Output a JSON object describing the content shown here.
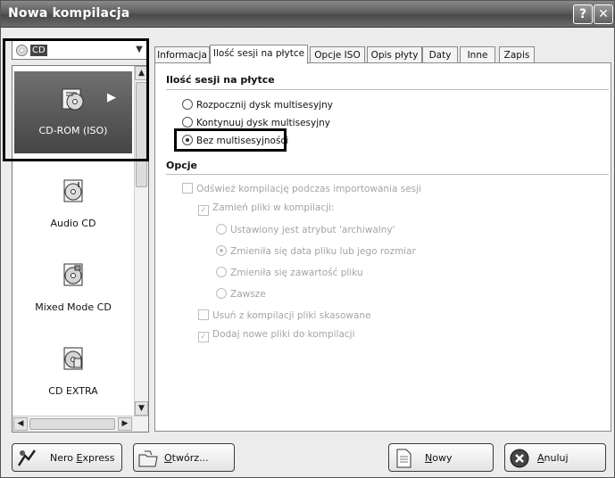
{
  "window": {
    "title": "Nowa kompilacja",
    "help_glyph": "?",
    "close_glyph": "✕"
  },
  "left": {
    "combo_value": "CD",
    "items": [
      {
        "label": "CD-ROM (ISO)",
        "icon": "cd-rom-iso-icon",
        "selected": true
      },
      {
        "label": "Audio CD",
        "icon": "audio-cd-icon"
      },
      {
        "label": "Mixed Mode CD",
        "icon": "mixed-mode-cd-icon"
      },
      {
        "label": "CD EXTRA",
        "icon": "cd-extra-icon"
      }
    ]
  },
  "tabs": [
    "Informacja",
    "Ilość sesji na płytce",
    "Opcje ISO",
    "Opis płyty",
    "Daty",
    "Inne",
    "Zapis"
  ],
  "active_tab": 1,
  "session": {
    "title": "Ilość sesji na płytce",
    "opt_start": "Rozpocznij dysk multisesyjny",
    "opt_continue": "Kontynuuj dysk multisesyjny",
    "opt_none": "Bez multisesyjności"
  },
  "options": {
    "title": "Opcje",
    "refresh": "Odśwież kompilację podczas importowania sesji",
    "replace": "Zamień pliki w kompilacji:",
    "archive": "Ustawiony jest atrybut 'archiwalny'",
    "date_size": "Zmieniła się data pliku lub jego rozmiar",
    "content": "Zmieniła się zawartość pliku",
    "always": "Zawsze",
    "remove_deleted": "Usuń z kompilacji pliki skasowane",
    "add_new": "Dodaj nowe pliki do kompilacji"
  },
  "buttons": {
    "nero_express_pre": "Nero ",
    "nero_express_key": "E",
    "nero_express_post": "xpress",
    "open_key": "O",
    "open_post": "twórz...",
    "new_key": "N",
    "new_post": "owy",
    "cancel_key": "A",
    "cancel_post": "nuluj"
  },
  "colors": {
    "title_bar": "#5c5c5c",
    "selected_item": "#555555",
    "disabled_text": "#a4a4a4"
  }
}
